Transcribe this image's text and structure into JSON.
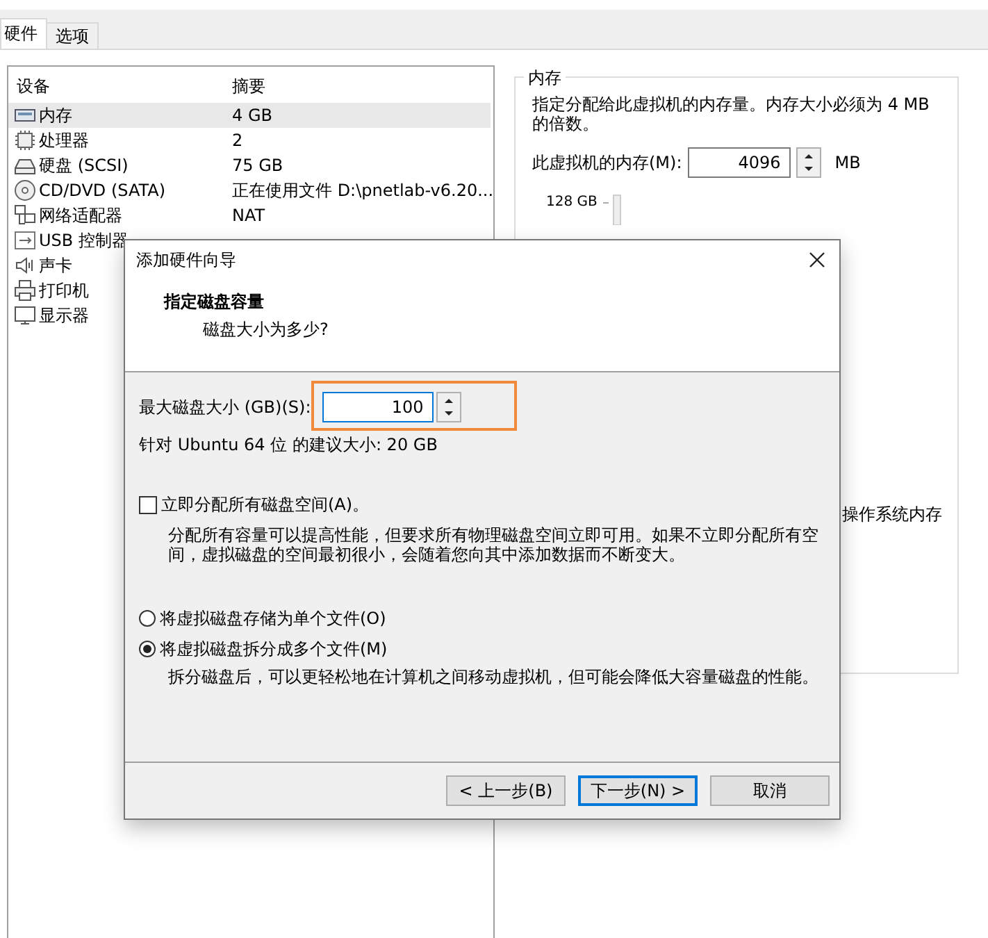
{
  "tabs": [
    {
      "label": "硬件",
      "selected": true
    },
    {
      "label": "选项",
      "selected": false
    }
  ],
  "devices": {
    "columns": [
      "设备",
      "摘要"
    ],
    "rows": [
      {
        "kind": "memory",
        "name": "内存",
        "summary": "4 GB",
        "selected": true
      },
      {
        "kind": "cpu",
        "name": "处理器",
        "summary": "2",
        "selected": false
      },
      {
        "kind": "disk",
        "name": "硬盘 (SCSI)",
        "summary": "75 GB",
        "selected": false
      },
      {
        "kind": "cd",
        "name": "CD/DVD (SATA)",
        "summary": "正在使用文件 D:\\pnetlab-v6.20...",
        "selected": false
      },
      {
        "kind": "network",
        "name": "网络适配器",
        "summary": "NAT",
        "selected": false
      },
      {
        "kind": "usb",
        "name": "USB 控制器",
        "selected": false
      },
      {
        "kind": "sound",
        "name": "声卡",
        "selected": false
      },
      {
        "kind": "printer",
        "name": "打印机",
        "selected": false
      },
      {
        "kind": "display",
        "name": "显示器",
        "selected": false
      }
    ]
  },
  "memory_panel": {
    "title": "内存",
    "description": "指定分配给此虚拟机的内存量。内存大小必须为 4 MB 的倍数。",
    "memory_label": "此虚拟机的内存(M):",
    "memory_value": "4096",
    "unit": "MB",
    "slider_label": "128 GB",
    "note_fragment": "操作系统内存"
  },
  "dialog": {
    "title": "添加硬件向导",
    "heading": "指定磁盘容量",
    "subheading": "磁盘大小为多少?",
    "size_label": "最大磁盘大小 (GB)(S):",
    "size_value": "100",
    "recommendation": "针对 Ubuntu 64 位 的建议大小: 20 GB",
    "allocate": {
      "label": "立即分配所有磁盘空间(A)。",
      "checked": false,
      "description": "分配所有容量可以提高性能，但要求所有物理磁盘空间立即可用。如果不立即分配所有空间，虚拟磁盘的空间最初很小，会随着您向其中添加数据而不断变大。"
    },
    "storage_options": [
      {
        "label": "将虚拟磁盘存储为单个文件(O)",
        "selected": false
      },
      {
        "label": "将虚拟磁盘拆分成多个文件(M)",
        "selected": true,
        "description": "拆分磁盘后，可以更轻松地在计算机之间移动虚拟机，但可能会降低大容量磁盘的性能。"
      }
    ],
    "buttons": [
      {
        "label": "< 上一步(B)",
        "default": false
      },
      {
        "label": "下一步(N) >",
        "default": true
      },
      {
        "label": "取消",
        "default": false
      }
    ]
  }
}
